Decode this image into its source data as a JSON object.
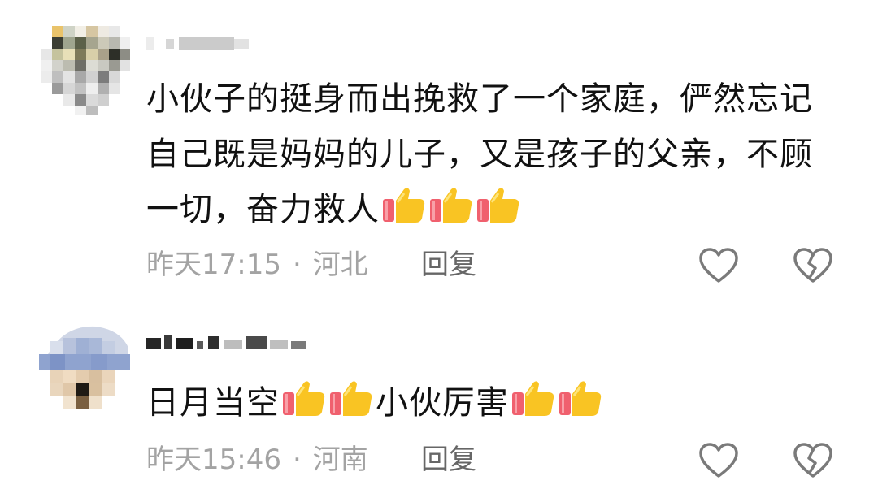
{
  "comments": [
    {
      "text": "小伙子的挺身而出挽救了一个家庭，俨然忘记自己既是妈妈的儿子，又是孩子的父亲，不顾一切，奋力救人",
      "emoji_icon": "thumbs-up-emoji",
      "emoji_count": 3,
      "time": "昨天17:15",
      "separator": "·",
      "location": "河北",
      "reply_label": "回复"
    },
    {
      "text_before": "日月当空",
      "text_middle": "小伙厉害",
      "emoji_icon": "thumbs-up-emoji",
      "time": "昨天15:46",
      "separator": "·",
      "location": "河南",
      "reply_label": "回复"
    }
  ],
  "icons": {
    "like": "heart-outline-icon",
    "dislike": "broken-heart-outline-icon"
  },
  "colors": {
    "meta_text": "#a3a3a3",
    "icon_stroke": "#7a7a7a"
  }
}
